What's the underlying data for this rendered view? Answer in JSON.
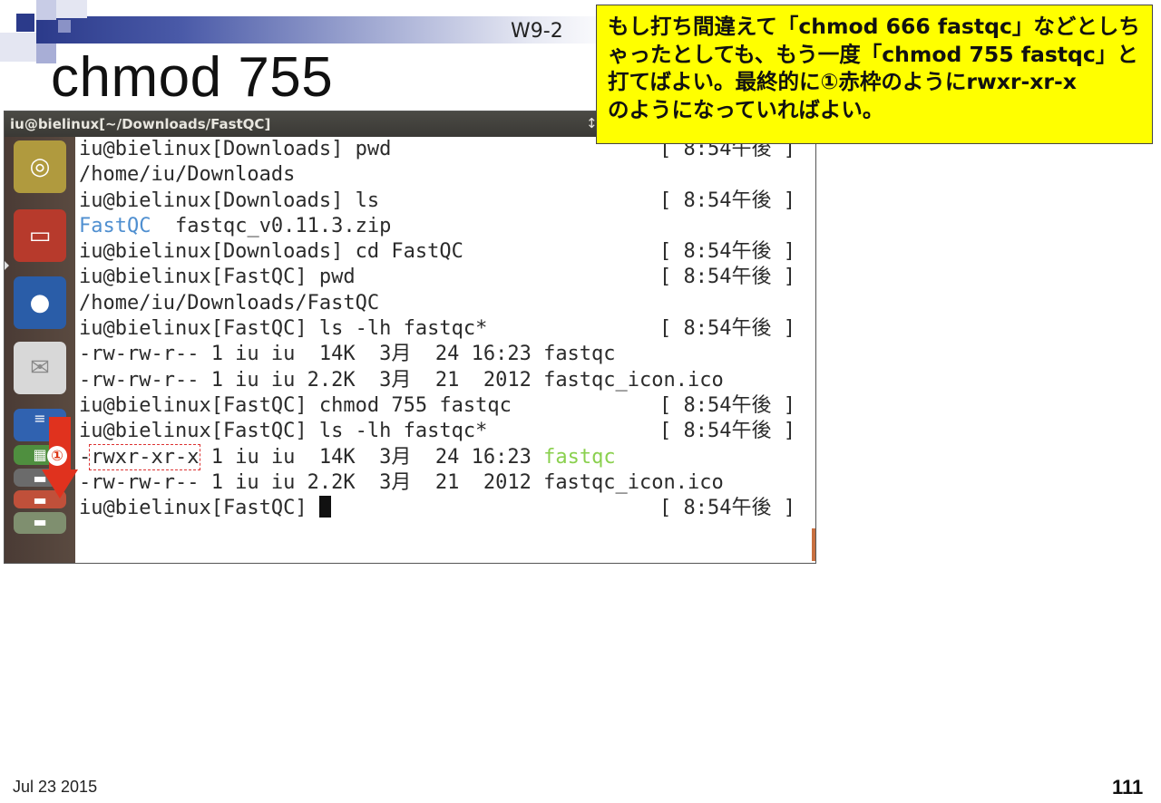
{
  "slide": {
    "label": "W9-2",
    "title": "chmod 755",
    "date": "Jul 23 2015",
    "page": "111"
  },
  "callout": {
    "lines": [
      "もし打ち間違えて「chmod 666 fastqc」などとしち",
      "ゃったとしても、もう一度「chmod 755 fastqc」と",
      "打てばよい。最終的に①赤枠のようにrwxr-xr-x",
      "のようになっていればよい。"
    ]
  },
  "badge": "①",
  "terminal": {
    "title": "iu@bielinux[~/Downloads/FastQC]",
    "title_icon": "↕",
    "lines": [
      {
        "text": "iu@bielinux[Downloads] pwd",
        "ts": "[ 8:54午後 ]"
      },
      {
        "text": "/home/iu/Downloads",
        "ts": ""
      },
      {
        "text": "iu@bielinux[Downloads] ls",
        "ts": "[ 8:54午後 ]"
      },
      {
        "pre": "FastQC",
        "text": "  fastqc_v0.11.3.zip",
        "ts": ""
      },
      {
        "text": "iu@bielinux[Downloads] cd FastQC",
        "ts": "[ 8:54午後 ]"
      },
      {
        "text": "iu@bielinux[FastQC] pwd",
        "ts": "[ 8:54午後 ]"
      },
      {
        "text": "/home/iu/Downloads/FastQC",
        "ts": ""
      },
      {
        "text": "iu@bielinux[FastQC] ls -lh fastqc*",
        "ts": "[ 8:54午後 ]"
      },
      {
        "text": "-rw-rw-r-- 1 iu iu  14K  3月  24 16:23 fastqc",
        "ts": ""
      },
      {
        "text": "-rw-rw-r-- 1 iu iu 2.2K  3月  21  2012 fastqc_icon.ico",
        "ts": ""
      },
      {
        "text": "iu@bielinux[FastQC] chmod 755 fastqc",
        "ts": "[ 8:54午後 ]"
      },
      {
        "text": "iu@bielinux[FastQC] ls -lh fastqc*",
        "ts": "[ 8:54午後 ]"
      },
      {
        "pre": "-",
        "perm": "rwxr-xr-x",
        "text": " 1 iu iu  14K  3月  24 16:23 ",
        "post": "fastqc",
        "ts": ""
      },
      {
        "text": "-rw-rw-r-- 1 iu iu 2.2K  3月  21  2012 fastqc_icon.ico",
        "ts": ""
      },
      {
        "text": "iu@bielinux[FastQC] ",
        "ts": "[ 8:54午後 ]"
      }
    ]
  },
  "launcher": {
    "icons": [
      "dash-icon",
      "files-icon",
      "firefox-icon",
      "mail-icon",
      "writer-icon",
      "calc-icon",
      "stack-icon",
      "stack-icon",
      "stack-icon"
    ]
  }
}
